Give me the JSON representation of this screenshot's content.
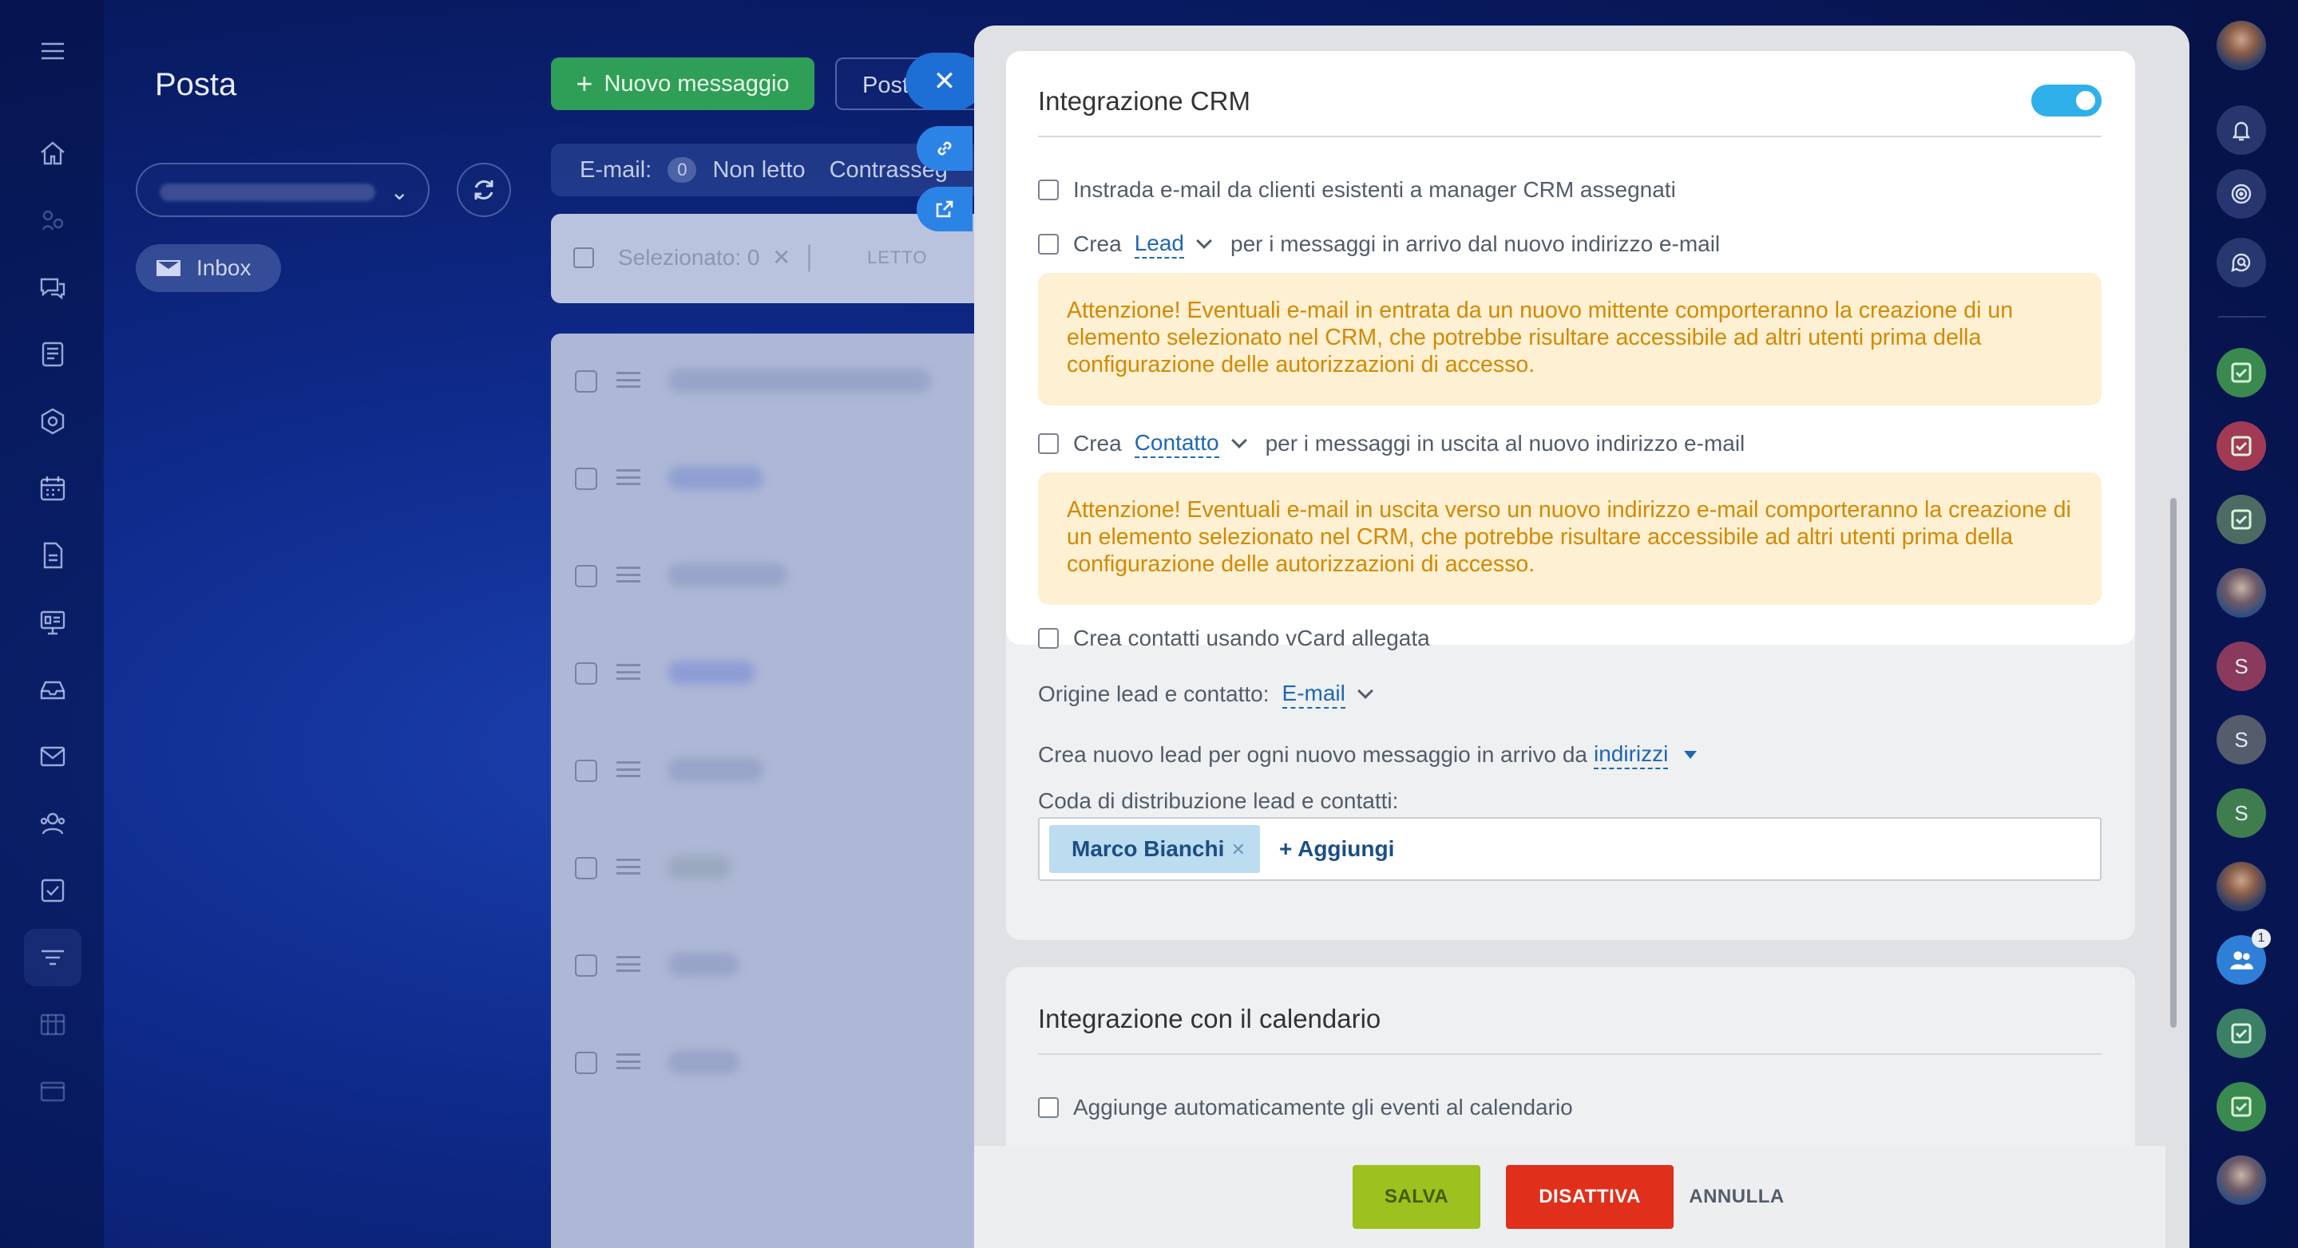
{
  "colors": {
    "toggle_on": "#2fb0ea",
    "link": "#2067b0",
    "warning_bg": "#fdf0d3",
    "warning_text": "#d38900",
    "save_btn": "#9dc11f",
    "disable_btn": "#e02f1a",
    "new_message_btn": "#2f9f57"
  },
  "left_nav": {
    "icons": [
      "menu-icon",
      "home-icon",
      "crm-icon",
      "chat-icon",
      "feed-icon",
      "hexagon-icon",
      "calendar-icon",
      "document-icon",
      "board-icon",
      "inbox-tray-icon",
      "mail-icon",
      "contacts-icon",
      "tasks-icon",
      "filter-icon",
      "grid-icon",
      "window-icon"
    ]
  },
  "mail": {
    "title": "Posta",
    "new_message_label": "Nuovo messaggio",
    "post_tab_label": "Post",
    "filter": {
      "email_label": "E-mail:",
      "unread_count": "0",
      "unread_label": "Non letto",
      "flagged_label": "Contrasseg"
    },
    "selected_label": "Selezionato: 0",
    "read_label": "LETTO",
    "inbox_label": "Inbox"
  },
  "crm": {
    "title": "Integrazione CRM",
    "toggle_on": true,
    "opt_route_label": "Instrada e-mail da clienti esistenti a manager CRM assegnati",
    "opt_create_word": "Crea",
    "opt_incoming_entity": "Lead",
    "opt_incoming_suffix": "per i messaggi in arrivo dal nuovo indirizzo e-mail",
    "warning_incoming": "Attenzione! Eventuali e-mail in entrata da un nuovo mittente comporteranno la creazione di un elemento selezionato nel CRM, che potrebbe risultare accessibile ad altri utenti prima della configurazione delle autorizzazioni di accesso.",
    "opt_outgoing_entity": "Contatto",
    "opt_outgoing_suffix": "per i messaggi in uscita al nuovo indirizzo e-mail",
    "warning_outgoing": "Attenzione! Eventuali e-mail in uscita verso un nuovo indirizzo e-mail comporteranno la creazione di un elemento selezionato nel CRM, che potrebbe risultare accessibile ad altri utenti prima della configurazione delle autorizzazioni di accesso.",
    "opt_vcard_label": "Crea contatti usando vCard allegata",
    "source_label": "Origine lead e contatto:",
    "source_value": "E-mail",
    "new_lead_text": "Crea nuovo lead per ogni nuovo messaggio in arrivo da",
    "new_lead_link": "indirizzi",
    "queue_label": "Coda di distribuzione lead e contatti:",
    "queue_user": "Marco Bianchi",
    "queue_add": "+ Aggiungi"
  },
  "calendar": {
    "title": "Integrazione con il calendario",
    "opt_auto_events": "Aggiunge automaticamente gli eventi al calendario"
  },
  "footer": {
    "save": "SALVA",
    "disable": "DISATTIVA",
    "cancel": "ANNULLA"
  },
  "right_rail": {
    "items": [
      "user-avatar",
      "bell-icon",
      "target-icon",
      "search-chat-icon",
      "task-icon",
      "task-icon",
      "task-icon",
      "user-avatar",
      "S",
      "S",
      "S",
      "user-avatar",
      "group-chat-icon",
      "task-icon",
      "task-icon",
      "user-avatar"
    ],
    "notification_count": "1"
  }
}
